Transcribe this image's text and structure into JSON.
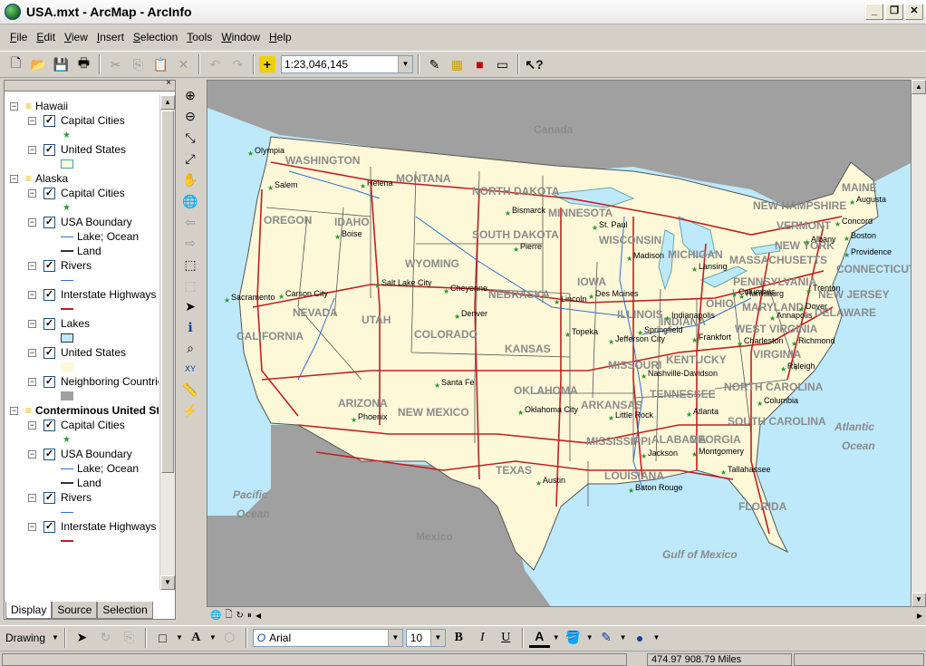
{
  "window": {
    "title": "USA.mxt - ArcMap - ArcInfo"
  },
  "menu": [
    {
      "pre": "",
      "ul": "F",
      "post": "ile"
    },
    {
      "pre": "",
      "ul": "E",
      "post": "dit"
    },
    {
      "pre": "",
      "ul": "V",
      "post": "iew"
    },
    {
      "pre": "",
      "ul": "I",
      "post": "nsert"
    },
    {
      "pre": "",
      "ul": "S",
      "post": "election"
    },
    {
      "pre": "",
      "ul": "T",
      "post": "ools"
    },
    {
      "pre": "",
      "ul": "W",
      "post": "indow"
    },
    {
      "pre": "",
      "ul": "H",
      "post": "elp"
    }
  ],
  "toolbar": {
    "scale": "1:23,046,145"
  },
  "toc": {
    "items": [
      {
        "kind": "frame",
        "label": "Hawaii",
        "bold": false
      },
      {
        "kind": "layer",
        "label": "Capital Cities",
        "checked": true
      },
      {
        "kind": "sym",
        "sym": "star"
      },
      {
        "kind": "layer",
        "label": "United States",
        "checked": true
      },
      {
        "kind": "sym",
        "sym": "box-yellow"
      },
      {
        "kind": "frame",
        "label": "Alaska",
        "bold": false
      },
      {
        "kind": "layer",
        "label": "Capital Cities",
        "checked": true
      },
      {
        "kind": "sym",
        "sym": "star"
      },
      {
        "kind": "layer",
        "label": "USA Boundary",
        "checked": true
      },
      {
        "kind": "sym",
        "sym": "line-blue",
        "text": "Lake; Ocean"
      },
      {
        "kind": "sym",
        "sym": "line-black",
        "text": "Land"
      },
      {
        "kind": "layer",
        "label": "Rivers",
        "checked": true
      },
      {
        "kind": "sym",
        "sym": "line-blue"
      },
      {
        "kind": "layer",
        "label": "Interstate Highways",
        "checked": true
      },
      {
        "kind": "sym",
        "sym": "line-red"
      },
      {
        "kind": "layer",
        "label": "Lakes",
        "checked": true
      },
      {
        "kind": "sym",
        "sym": "box-blue"
      },
      {
        "kind": "layer",
        "label": "United States",
        "checked": true
      },
      {
        "kind": "sym",
        "sym": "box-yellow2"
      },
      {
        "kind": "layer",
        "label": "Neighboring Countries",
        "checked": true
      },
      {
        "kind": "sym",
        "sym": "box-gray"
      },
      {
        "kind": "frame",
        "label": "Conterminous United States",
        "bold": true
      },
      {
        "kind": "layer",
        "label": "Capital Cities",
        "checked": true
      },
      {
        "kind": "sym",
        "sym": "star"
      },
      {
        "kind": "layer",
        "label": "USA Boundary",
        "checked": true
      },
      {
        "kind": "sym",
        "sym": "line-blue",
        "text": "Lake; Ocean"
      },
      {
        "kind": "sym",
        "sym": "line-black",
        "text": "Land"
      },
      {
        "kind": "layer",
        "label": "Rivers",
        "checked": true
      },
      {
        "kind": "sym",
        "sym": "line-blue"
      },
      {
        "kind": "layer",
        "label": "Interstate Highways",
        "checked": true
      },
      {
        "kind": "sym",
        "sym": "line-red"
      }
    ],
    "tabs": [
      "Display",
      "Source",
      "Selection"
    ]
  },
  "map": {
    "countries": [
      "Canada",
      "Mexico"
    ],
    "oceans": [
      "Pacific Ocean",
      "Atlantic Ocean",
      "Gulf of Mexico"
    ],
    "states": [
      "WASHINGTON",
      "OREGON",
      "CALIFORNIA",
      "NEVADA",
      "IDAHO",
      "MONTANA",
      "WYOMING",
      "UTAH",
      "ARIZONA",
      "COLORADO",
      "NEW MEXICO",
      "NORTH DAKOTA",
      "SOUTH DAKOTA",
      "NEBRASKA",
      "KANSAS",
      "OKLAHOMA",
      "TEXAS",
      "MINNESOTA",
      "IOWA",
      "MISSOURI",
      "ARKANSAS",
      "LOUISIANA",
      "WISCONSIN",
      "ILLINOIS",
      "MISSISSIPPI",
      "MICHIGAN",
      "INDIANA",
      "KENTUCKY",
      "TENNESSEE",
      "ALABAMA",
      "GEORGIA",
      "FLORIDA",
      "OHIO",
      "WEST VIRGINIA",
      "VIRGINIA",
      "NORTH CAROLINA",
      "SOUTH CAROLINA",
      "PENNSYLVANIA",
      "NEW YORK",
      "MAINE",
      "VERMONT",
      "NEW HAMPSHIRE",
      "MASSACHUSETTS",
      "CONNECTICUT",
      "NEW JERSEY",
      "DELAWARE",
      "MARYLAND"
    ],
    "cities": [
      "Olympia",
      "Salem",
      "Helena",
      "Boise",
      "Sacramento",
      "Carson City",
      "Salt Lake City",
      "Cheyenne",
      "Denver",
      "Phoenix",
      "Santa Fe",
      "Bismarck",
      "Pierre",
      "Lincoln",
      "Topeka",
      "Oklahoma City",
      "Austin",
      "St. Paul",
      "Des Moines",
      "Jefferson City",
      "Little Rock",
      "Baton Rouge",
      "Madison",
      "Springfield",
      "Jackson",
      "Lansing",
      "Indianapolis",
      "Nashville-Davidson",
      "Montgomery",
      "Atlanta",
      "Tallahassee",
      "Columbus",
      "Frankfort",
      "Charleston",
      "Columbia",
      "Raleigh",
      "Richmond",
      "Harrisburg",
      "Albany",
      "Augusta",
      "Concord",
      "Boston",
      "Providence",
      "Trenton",
      "Dover",
      "Annapolis"
    ]
  },
  "drawing": {
    "label": "Drawing",
    "font": "Arial",
    "size": "10"
  },
  "status": {
    "coords": "474.97  908.79 Miles"
  }
}
